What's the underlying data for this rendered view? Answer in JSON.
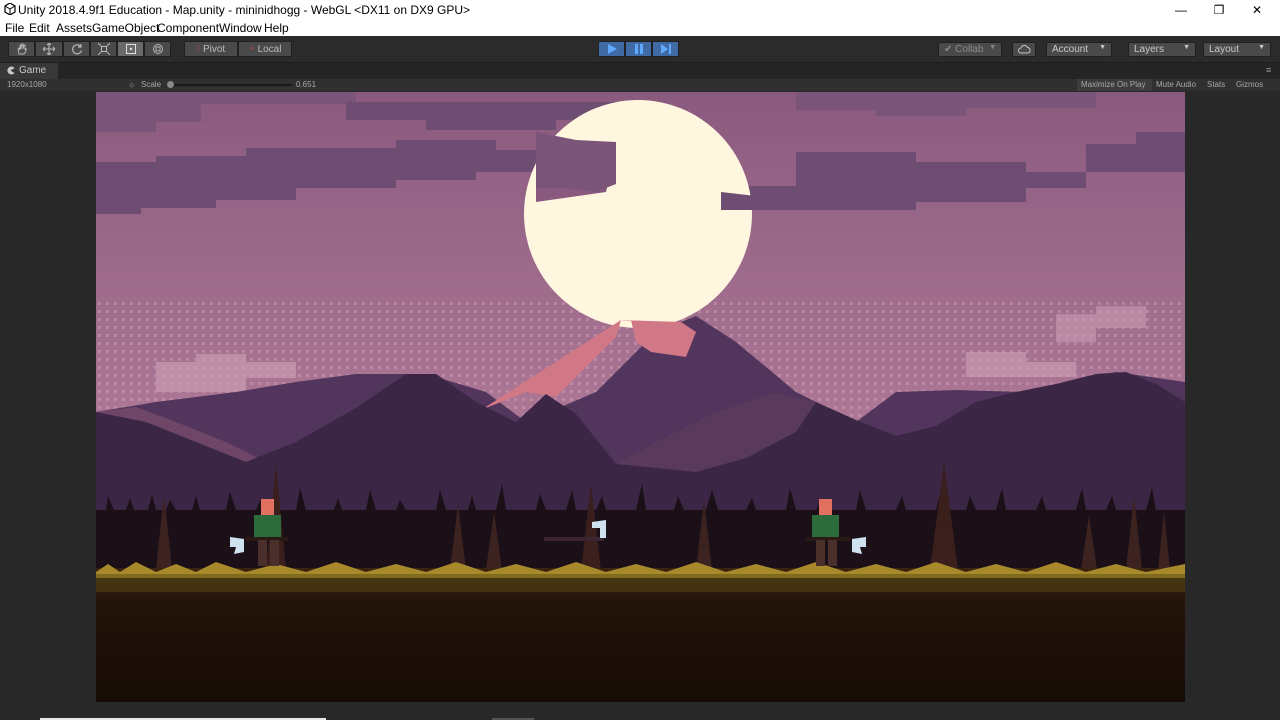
{
  "window": {
    "title": "Unity 2018.4.9f1 Education - Map.unity - mininidhogg - WebGL <DX11 on DX9 GPU>",
    "minimize_glyph": "—",
    "maximize_glyph": "❐",
    "close_glyph": "✕"
  },
  "menu": [
    "File",
    "Edit",
    "Assets",
    "GameObject",
    "Component",
    "Window",
    "Help"
  ],
  "toolbar": {
    "pivot_label": "Pivot",
    "local_label": "Local",
    "collab_label": "Collab",
    "account_label": "Account",
    "layers_label": "Layers",
    "layout_label": "Layout"
  },
  "game_tab": {
    "label": "Game",
    "resolution": "1920x1080",
    "scale_label": "Scale",
    "scale_value": "0.651",
    "maximize_on_play": "Maximize On Play",
    "mute_audio": "Mute Audio",
    "stats": "Stats",
    "gizmos": "Gizmos"
  },
  "colors": {
    "editor_bg": "#282828",
    "play_accent": "#3f6aa4",
    "sky_top": "#8a5a7e",
    "sky_bottom": "#b9859f",
    "moon": "#fff6df",
    "ground": "#1c0f09",
    "grass": "#7f6a1e"
  }
}
